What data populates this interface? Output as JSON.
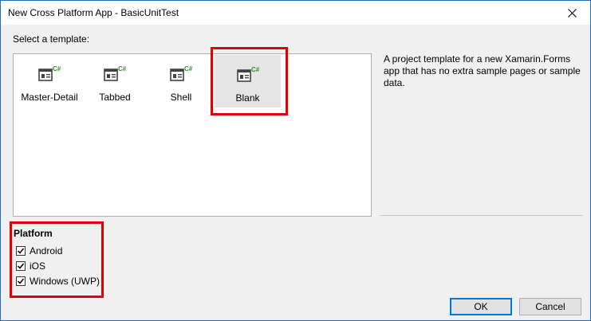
{
  "window": {
    "title": "New Cross Platform App - BasicUnitTest",
    "close_glyph": "✕"
  },
  "templates": {
    "label": "Select a template:",
    "items": [
      {
        "label": "Master-Detail",
        "icon": "xamarin-template-icon",
        "badge": "C#"
      },
      {
        "label": "Tabbed",
        "icon": "xamarin-template-icon",
        "badge": "C#"
      },
      {
        "label": "Shell",
        "icon": "xamarin-template-icon",
        "badge": "C#"
      },
      {
        "label": "Blank",
        "icon": "xamarin-template-icon",
        "badge": "C#",
        "selected": true
      }
    ],
    "description": "A project template for a new Xamarin.Forms app that has no extra sample pages or sample data."
  },
  "platform": {
    "title": "Platform",
    "options": [
      {
        "label": "Android",
        "checked": true
      },
      {
        "label": "iOS",
        "checked": true
      },
      {
        "label": "Windows (UWP)",
        "checked": true
      }
    ]
  },
  "buttons": {
    "ok": "OK",
    "cancel": "Cancel"
  },
  "colors": {
    "highlight_border": "#e10000",
    "selected_tile_bg": "#e5e5e5",
    "csharp_badge": "#2e8b2e",
    "default_button_border": "#0078d7"
  }
}
